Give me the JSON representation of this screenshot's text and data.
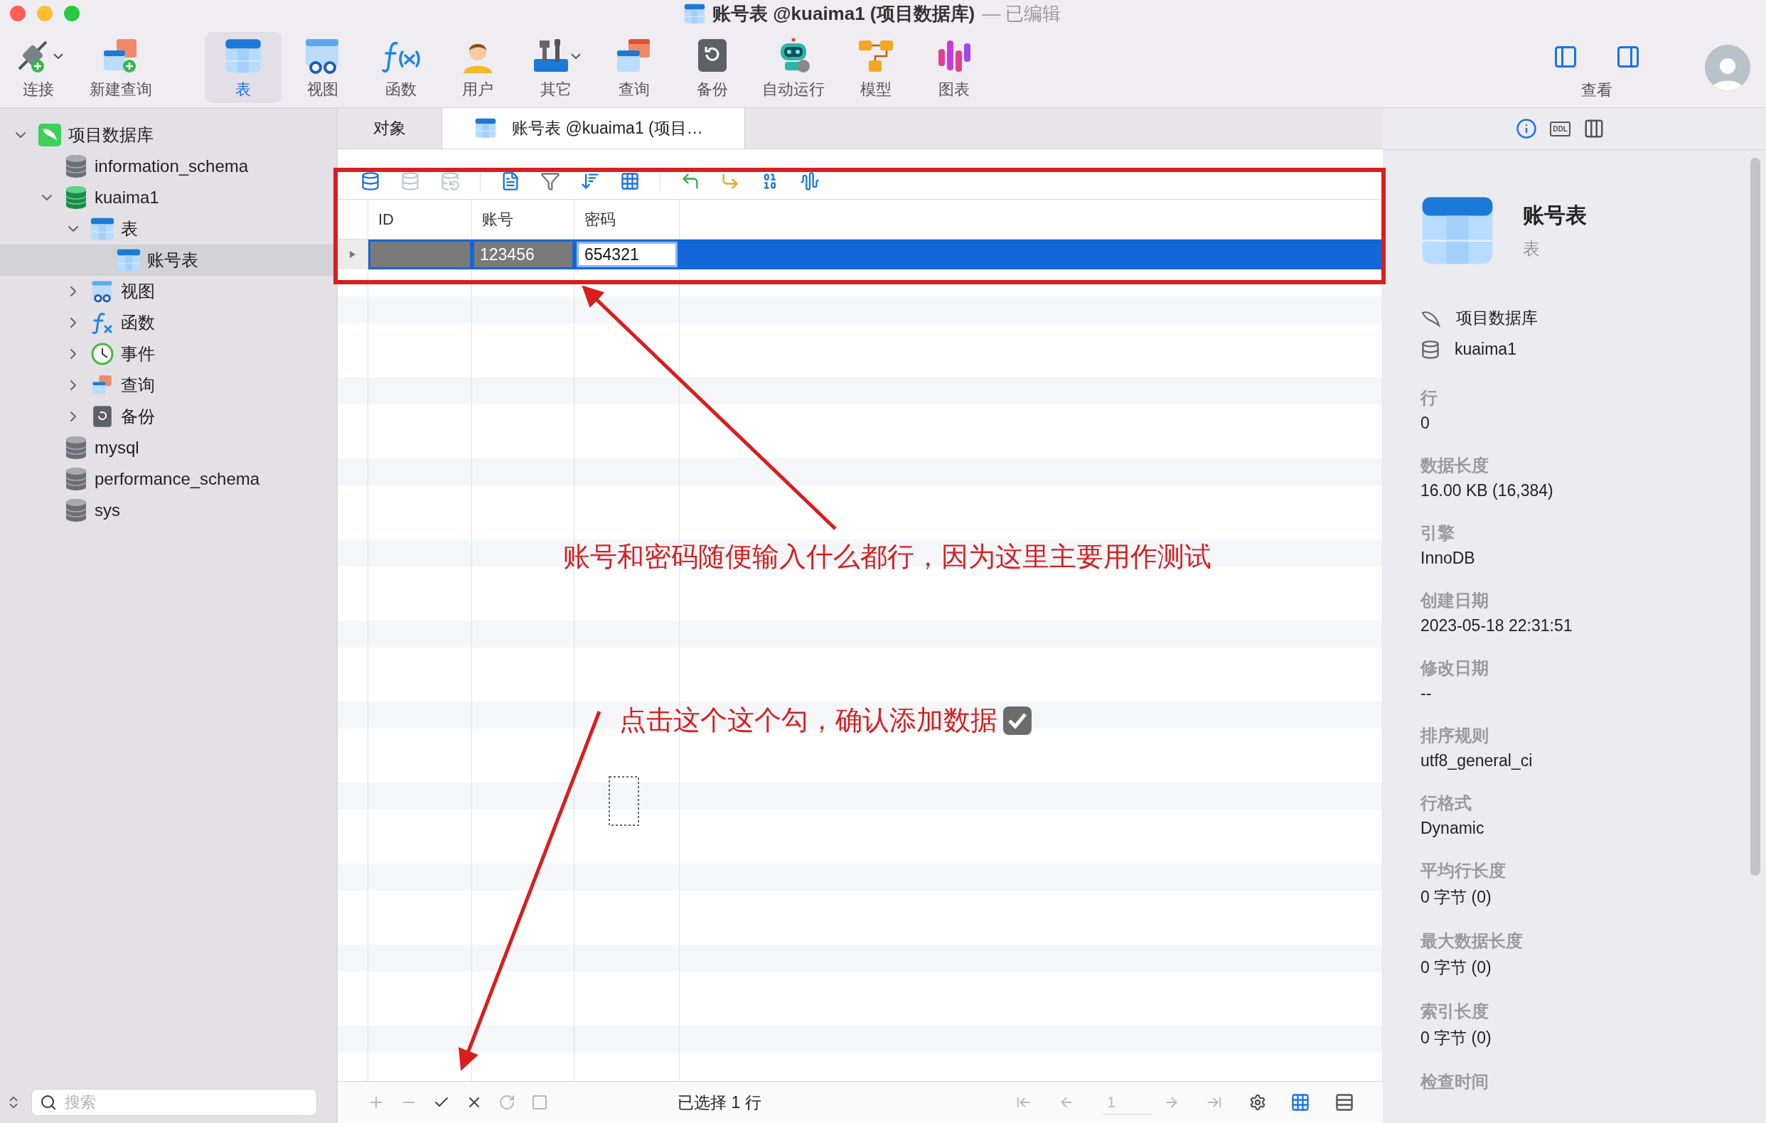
{
  "window": {
    "title": "账号表 @kuaima1 (项目数据库)",
    "status": "— 已编辑"
  },
  "toolbar": [
    {
      "kind": "connect",
      "label": "连接",
      "selected": false,
      "dropdown": true
    },
    {
      "kind": "new-query",
      "label": "新建查询",
      "selected": false,
      "dropdown": false
    },
    {
      "kind": "table",
      "label": "表",
      "selected": true,
      "dropdown": false
    },
    {
      "kind": "view",
      "label": "视图",
      "selected": false,
      "dropdown": false
    },
    {
      "kind": "function",
      "label": "函数",
      "selected": false,
      "dropdown": false
    },
    {
      "kind": "user",
      "label": "用户",
      "selected": false,
      "dropdown": false
    },
    {
      "kind": "other",
      "label": "其它",
      "selected": false,
      "dropdown": true
    },
    {
      "kind": "query",
      "label": "查询",
      "selected": false,
      "dropdown": false
    },
    {
      "kind": "backup",
      "label": "备份",
      "selected": false,
      "dropdown": false
    },
    {
      "kind": "automation",
      "label": "自动运行",
      "selected": false,
      "dropdown": false
    },
    {
      "kind": "model",
      "label": "模型",
      "selected": false,
      "dropdown": false
    },
    {
      "kind": "chart",
      "label": "图表",
      "selected": false,
      "dropdown": false
    }
  ],
  "view": {
    "label": "查看"
  },
  "sidebar": {
    "tree": [
      {
        "kind": "connection",
        "label": "项目数据库",
        "expanded": true,
        "selected": false,
        "children": [
          {
            "kind": "database",
            "label": "information_schema",
            "open": false,
            "selected": false
          },
          {
            "kind": "database",
            "label": "kuaima1",
            "open": true,
            "expanded": true,
            "selected": false,
            "children": [
              {
                "kind": "tables",
                "label": "表",
                "expanded": true,
                "selected": false,
                "children": [
                  {
                    "kind": "table",
                    "label": "账号表",
                    "selected": true
                  }
                ]
              },
              {
                "kind": "views",
                "label": "视图",
                "expanded": false,
                "selected": false
              },
              {
                "kind": "functions",
                "label": "函数",
                "expanded": false,
                "selected": false
              },
              {
                "kind": "events",
                "label": "事件",
                "expanded": false,
                "selected": false
              },
              {
                "kind": "queries",
                "label": "查询",
                "expanded": false,
                "selected": false
              },
              {
                "kind": "backups",
                "label": "备份",
                "expanded": false,
                "selected": false
              }
            ]
          },
          {
            "kind": "database",
            "label": "mysql",
            "open": false,
            "selected": false
          },
          {
            "kind": "database",
            "label": "performance_schema",
            "open": false,
            "selected": false
          },
          {
            "kind": "database",
            "label": "sys",
            "open": false,
            "selected": false
          }
        ]
      }
    ],
    "search": {
      "placeholder": "搜索"
    }
  },
  "tabs": [
    {
      "label": "对象",
      "selected": false
    },
    {
      "label": "账号表 @kuaima1 (项目…",
      "selected": true
    }
  ],
  "grid_toolbar": [
    {
      "kind": "begin",
      "disabled": false
    },
    {
      "kind": "commit",
      "disabled": true
    },
    {
      "kind": "rollback",
      "disabled": true
    },
    {
      "kind": "text",
      "disabled": false
    },
    {
      "kind": "filter",
      "disabled": false
    },
    {
      "kind": "sort",
      "disabled": false
    },
    {
      "kind": "grid",
      "disabled": false
    },
    {
      "kind": "import",
      "disabled": false
    },
    {
      "kind": "export",
      "disabled": false
    },
    {
      "kind": "binary",
      "disabled": false
    },
    {
      "kind": "wave",
      "disabled": false
    }
  ],
  "grid": {
    "columns": [
      "ID",
      "账号",
      "密码"
    ],
    "rows": [
      {
        "selected": true,
        "cells": [
          {
            "kind": "masked"
          },
          {
            "kind": "masked",
            "value": "123456"
          },
          {
            "kind": "editing",
            "value": "654321"
          }
        ]
      }
    ]
  },
  "annotations": [
    {
      "text": "账号和密码随便输入什么都行，因为这里主要用作测试",
      "checkbox": false
    },
    {
      "text": "点击这个这个勾，确认添加数据",
      "checkbox": true
    }
  ],
  "bottom_bar": {
    "controls": [
      {
        "kind": "add",
        "disabled": true
      },
      {
        "kind": "remove",
        "disabled": true
      },
      {
        "kind": "apply",
        "disabled": false
      },
      {
        "kind": "discard",
        "disabled": false
      },
      {
        "kind": "refresh",
        "disabled": true
      },
      {
        "kind": "stop",
        "disabled": true
      }
    ],
    "status": "已选择 1 行",
    "page": "1",
    "nav": [
      {
        "kind": "first",
        "disabled": true
      },
      {
        "kind": "prev",
        "disabled": true
      },
      {
        "kind": "next",
        "disabled": true
      },
      {
        "kind": "last",
        "disabled": true
      }
    ],
    "views": [
      {
        "kind": "grid",
        "selected": true
      },
      {
        "kind": "form",
        "selected": false
      }
    ]
  },
  "info": {
    "tabs": [
      {
        "kind": "info",
        "selected": true
      },
      {
        "kind": "ddl",
        "label": "DDL",
        "selected": false
      },
      {
        "kind": "columns",
        "selected": false
      }
    ],
    "name": "账号表",
    "type": "表",
    "connection": "项目数据库",
    "database": "kuaima1",
    "fields": [
      {
        "label": "行",
        "value": "0"
      },
      {
        "label": "数据长度",
        "value": "16.00 KB (16,384)"
      },
      {
        "label": "引擎",
        "value": "InnoDB"
      },
      {
        "label": "创建日期",
        "value": "2023-05-18 22:31:51"
      },
      {
        "label": "修改日期",
        "value": "--"
      },
      {
        "label": "排序规则",
        "value": "utf8_general_ci"
      },
      {
        "label": "行格式",
        "value": "Dynamic"
      },
      {
        "label": "平均行长度",
        "value": "0 字节 (0)"
      },
      {
        "label": "最大数据长度",
        "value": "0 字节 (0)"
      },
      {
        "label": "索引长度",
        "value": "0 字节 (0)"
      },
      {
        "label": "检查时间"
      }
    ]
  }
}
